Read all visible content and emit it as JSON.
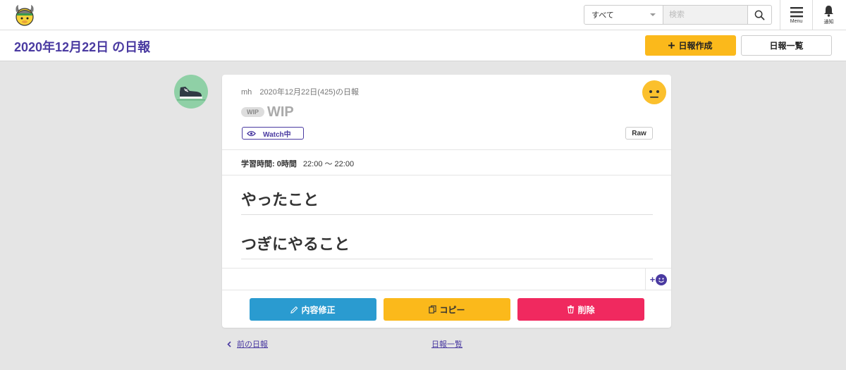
{
  "header": {
    "search": {
      "scope_value": "すべて",
      "placeholder": "検索",
      "value": ""
    },
    "menu_label": "Menu",
    "notification_label": "通知"
  },
  "page": {
    "title": "2020年12月22日 の日報",
    "create_button": "日報作成",
    "list_button": "日報一覧"
  },
  "report": {
    "user": "mh",
    "meta_text": "2020年12月22日(425)の日報",
    "wip_badge": "WIP",
    "title": "WIP",
    "watch_label": "Watch中",
    "raw_label": "Raw",
    "study_label": "学習時間: 0時間",
    "study_range": "22:00 〜 22:00",
    "sections": [
      "やったこと",
      "つぎにやること"
    ]
  },
  "actions": {
    "edit": "内容修正",
    "copy": "コピー",
    "delete": "削除"
  },
  "footer_nav": {
    "prev": "前の日報",
    "list": "日報一覧"
  },
  "colors": {
    "brand_purple": "#4a3aa1",
    "yellow": "#fbb91b",
    "blue": "#2a9bd0",
    "red": "#f0295f"
  }
}
